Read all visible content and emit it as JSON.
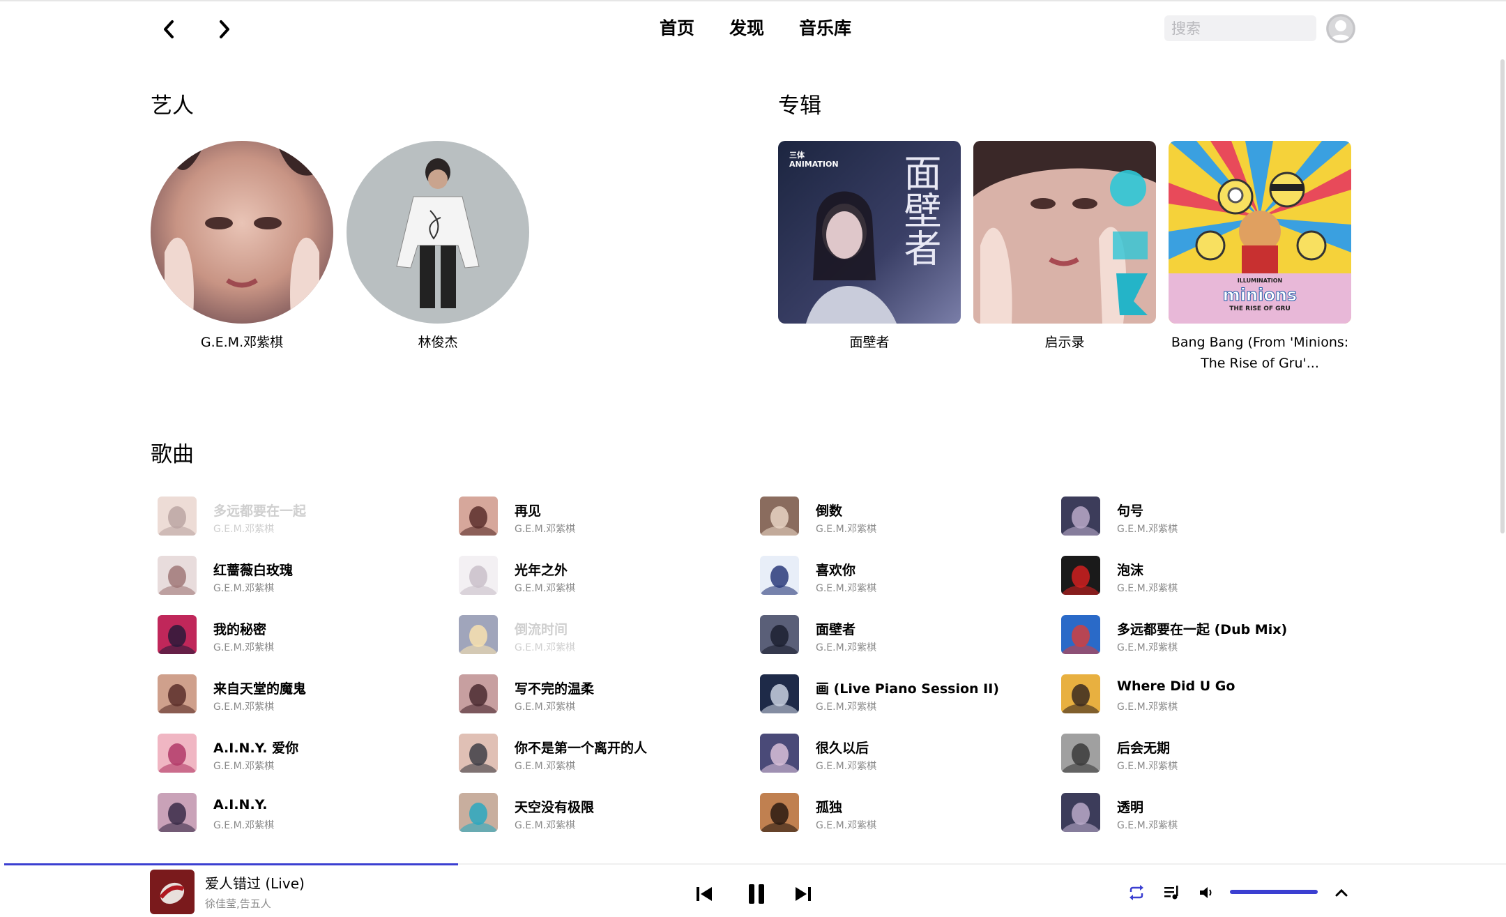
{
  "nav": {
    "back_icon": "chevron-left-icon",
    "forward_icon": "chevron-right-icon",
    "links": [
      "首页",
      "发现",
      "音乐库"
    ],
    "search_placeholder": "搜索"
  },
  "sections": {
    "artists_title": "艺人",
    "albums_title": "专辑",
    "songs_title": "歌曲"
  },
  "artists": [
    {
      "name": "G.E.M.邓紫棋"
    },
    {
      "name": "林俊杰"
    }
  ],
  "albums": [
    {
      "name": "面壁者",
      "cover_text": "面壁者",
      "cover_logo": "三体 ANIMATION"
    },
    {
      "name": "启示录"
    },
    {
      "name_line1": "Bang Bang (From 'Minions:",
      "name_line2": "The Rise of Gru'...",
      "cover_text": "minions",
      "cover_sub": "THE RISE OF GRU",
      "cover_logo": "ILLUMINATION"
    }
  ],
  "songs": [
    {
      "title": "多远都要在一起",
      "artist": "G.E.M.邓紫棋",
      "disabled": true
    },
    {
      "title": "红蔷薇白玫瑰",
      "artist": "G.E.M.邓紫棋"
    },
    {
      "title": "我的秘密",
      "artist": "G.E.M.邓紫棋"
    },
    {
      "title": "来自天堂的魔鬼",
      "artist": "G.E.M.邓紫棋"
    },
    {
      "title": "A.I.N.Y. 爱你",
      "artist": "G.E.M.邓紫棋"
    },
    {
      "title": "A.I.N.Y.",
      "artist": "G.E.M.邓紫棋"
    },
    {
      "title": "再见",
      "artist": "G.E.M.邓紫棋"
    },
    {
      "title": "光年之外",
      "artist": "G.E.M.邓紫棋"
    },
    {
      "title": "倒流时间",
      "artist": "G.E.M.邓紫棋",
      "disabled": true
    },
    {
      "title": "写不完的温柔",
      "artist": "G.E.M.邓紫棋"
    },
    {
      "title": "你不是第一个离开的人",
      "artist": "G.E.M.邓紫棋"
    },
    {
      "title": "天空没有极限",
      "artist": "G.E.M.邓紫棋"
    },
    {
      "title": "倒数",
      "artist": "G.E.M.邓紫棋"
    },
    {
      "title": "喜欢你",
      "artist": "G.E.M.邓紫棋"
    },
    {
      "title": "面壁者",
      "artist": "G.E.M.邓紫棋"
    },
    {
      "title": "画 (Live Piano Session II)",
      "artist": "G.E.M.邓紫棋"
    },
    {
      "title": "很久以后",
      "artist": "G.E.M.邓紫棋"
    },
    {
      "title": "孤独",
      "artist": "G.E.M.邓紫棋"
    },
    {
      "title": "句号",
      "artist": "G.E.M.邓紫棋"
    },
    {
      "title": "泡沫",
      "artist": "G.E.M.邓紫棋"
    },
    {
      "title": "多远都要在一起 (Dub Mix)",
      "artist": "G.E.M.邓紫棋"
    },
    {
      "title": "Where Did U Go",
      "artist": "G.E.M.邓紫棋"
    },
    {
      "title": "后会无期",
      "artist": "G.E.M.邓紫棋"
    },
    {
      "title": "透明",
      "artist": "G.E.M.邓紫棋"
    }
  ],
  "player": {
    "title": "爱人错过 (Live)",
    "artist": "徐佳莹,告五人",
    "progress": 0.302,
    "volume": 1.0,
    "icons": [
      "previous-icon",
      "pause-icon",
      "next-icon",
      "repeat-icon",
      "playlist-icon",
      "volume-icon",
      "chevron-up-icon"
    ],
    "accent_color": "#3b3fd1"
  },
  "thumb_colors": [
    [
      "#d8b3a5",
      "#6b3b36"
    ],
    [
      "#e8dcdc",
      "#a07878"
    ],
    [
      "#c0275a",
      "#2a1a3a"
    ],
    [
      "#cfa08c",
      "#5b2e2a"
    ],
    [
      "#f0b6c3",
      "#b23a68"
    ],
    [
      "#c9a2b8",
      "#3a2b48"
    ],
    [
      "#d6a79b",
      "#5a2e2c"
    ],
    [
      "#f3f0f3",
      "#c9bfc9"
    ],
    [
      "#2f3a6b",
      "#f0c050"
    ],
    [
      "#c79fa0",
      "#4a2a30"
    ],
    [
      "#e0c0b5",
      "#3e3e46"
    ],
    [
      "#c8ae9e",
      "#2aa8c0"
    ],
    [
      "#8a6c5e",
      "#e8d3c3"
    ],
    [
      "#e8eef8",
      "#2a3a7a"
    ],
    [
      "#5a5f78",
      "#1c2030"
    ],
    [
      "#1e2a48",
      "#c8d0e0"
    ],
    [
      "#4a4a78",
      "#d8c0d8"
    ],
    [
      "#c08050",
      "#2a1a10"
    ],
    [
      "#3c3c5a",
      "#b8a8c8"
    ],
    [
      "#1a1a1a",
      "#d02020"
    ],
    [
      "#2a6ac8",
      "#d04040"
    ],
    [
      "#e8b040",
      "#3a2a20"
    ],
    [
      "#a0a0a0",
      "#3a3a3a"
    ],
    [
      "#3c3c5a",
      "#b8a8c8"
    ]
  ]
}
